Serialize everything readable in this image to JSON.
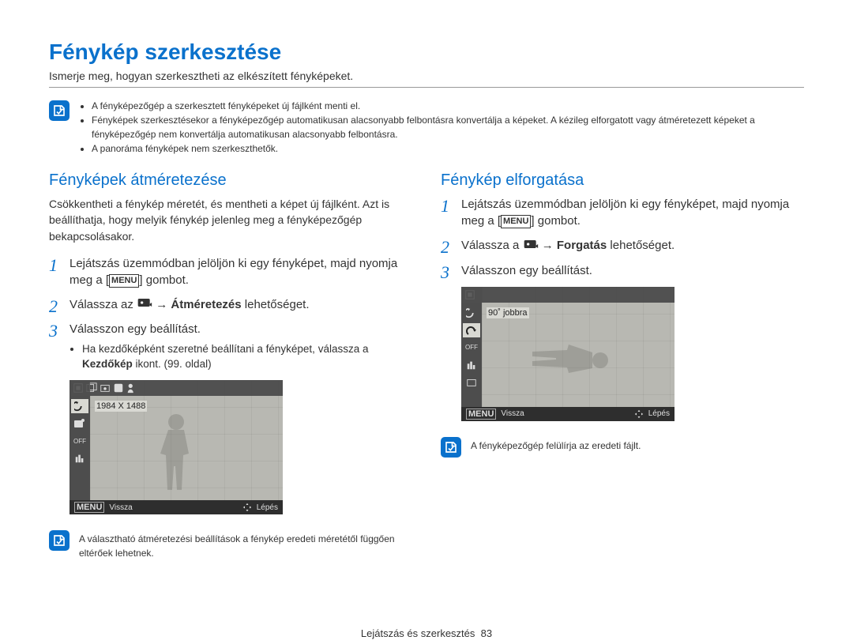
{
  "page": {
    "title": "Fénykép szerkesztése",
    "subtitle": "Ismerje meg, hogyan szerkesztheti az elkészített fényképeket."
  },
  "top_note": {
    "items": [
      "A fényképezőgép a szerkesztett fényképeket új fájlként menti el.",
      "Fényképek szerkesztésekor a fényképezőgép automatikusan alacsonyabb felbontásra konvertálja a képeket. A kézileg elforgatott vagy átméretezett képeket a fényképezőgép nem konvertálja automatikusan alacsonyabb felbontásra.",
      "A panoráma fényképek nem szerkeszthetők."
    ]
  },
  "left": {
    "heading": "Fényképek átméretezése",
    "desc": "Csökkentheti a fénykép méretét, és mentheti a képet új fájlként. Azt is beállíthatja, hogy melyik fénykép jelenleg meg a fényképezőgép bekapcsolásakor.",
    "step1_a": "Lejátszás üzemmódban jelöljön ki egy fényképet, majd nyomja meg a [",
    "step1_b": "] gombot.",
    "step2_a": "Válassza az ",
    "step2_b": " → ",
    "step2_c": "Átméretezés",
    "step2_d": " lehetőséget.",
    "step3": "Válasszon egy beállítást.",
    "sub_a": "Ha kezdőképként szeretné beállítani a fényképet, válassza a ",
    "sub_b": "Kezdőkép",
    "sub_c": " ikont.  (99. oldal)",
    "lcd_label": "1984 X 1488",
    "lcd_back": "Vissza",
    "lcd_set": "Lépés",
    "note": "A választható átméretezési beállítások a fénykép eredeti méretétől függően eltérőek lehetnek."
  },
  "right": {
    "heading": "Fénykép elforgatása",
    "step1_a": "Lejátszás üzemmódban jelöljön ki egy fényképet, majd nyomja meg a [",
    "step1_b": "] gombot.",
    "step2_a": "Válassza a ",
    "step2_b": " → ",
    "step2_c": "Forgatás",
    "step2_d": " lehetőséget.",
    "step3": "Válasszon egy beállítást.",
    "lcd_label": "90˚ jobbra",
    "lcd_back": "Vissza",
    "lcd_set": "Lépés",
    "note": "A fényképezőgép felülírja az eredeti fájlt."
  },
  "footer": {
    "section": "Lejátszás és szerkesztés",
    "page": "83"
  },
  "labels": {
    "menu_key": "MENU"
  }
}
